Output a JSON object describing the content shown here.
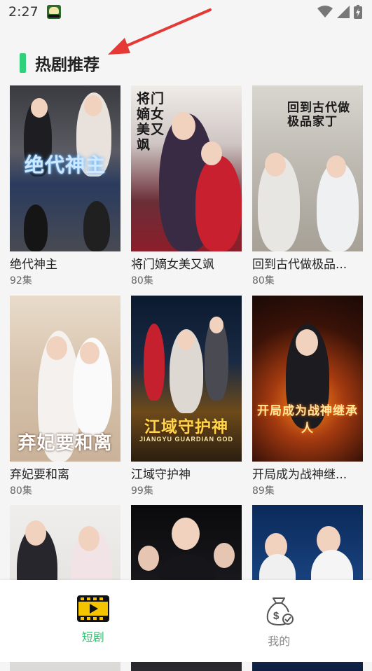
{
  "status": {
    "time": "2:27"
  },
  "section": {
    "title": "热剧推荐"
  },
  "dramas": [
    {
      "title": "绝代神主",
      "episodes": "92集",
      "art": "绝代神主"
    },
    {
      "title": "将门嫡女美又飒",
      "episodes": "80集",
      "art": "将门嫡女美又飒"
    },
    {
      "title": "回到古代做极品...",
      "episodes": "80集",
      "art": "回到古代做极品家丁"
    },
    {
      "title": "弃妃要和离",
      "episodes": "80集",
      "art": "弃妃要和离"
    },
    {
      "title": "江域守护神",
      "episodes": "99集",
      "art": "江域守护神",
      "art_sub": "JIANGYU GUARDIAN GOD"
    },
    {
      "title": "开局成为战神继...",
      "episodes": "89集",
      "art": "开局成为战神继承人"
    }
  ],
  "tabs": [
    {
      "label": "短剧",
      "icon": "film-icon",
      "active": true,
      "color": "#2fbf71"
    },
    {
      "label": "我的",
      "icon": "money-bag-icon",
      "active": false,
      "color": "#8a8a8a"
    }
  ],
  "colors": {
    "accent": "#2fd27a",
    "annotation_arrow": "#e53935"
  }
}
